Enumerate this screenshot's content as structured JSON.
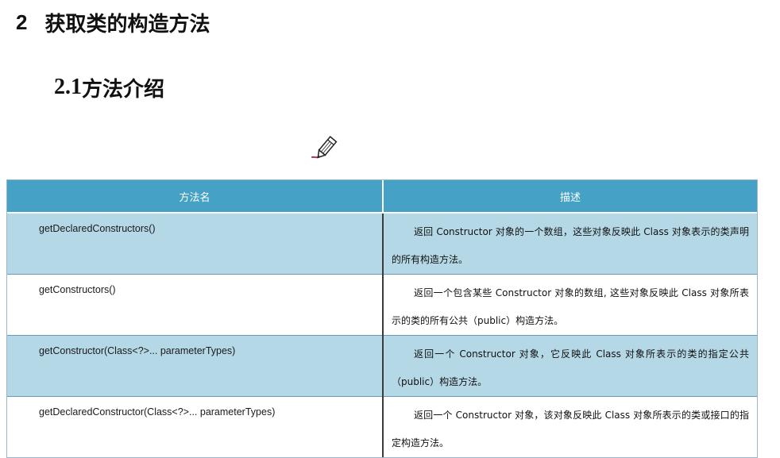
{
  "heading1": {
    "number": "2",
    "title": "获取类的构造方法"
  },
  "heading2": {
    "number": "2.1",
    "title": "方法介绍"
  },
  "table": {
    "headers": {
      "method": "方法名",
      "description": "描述"
    },
    "rows": [
      {
        "method": "getDeclaredConstructors()",
        "description": "返回 Constructor 对象的一个数组，这些对象反映此 Class 对象表示的类声明的所有构造方法。"
      },
      {
        "method": "getConstructors()",
        "description": "返回一个包含某些 Constructor 对象的数组, 这些对象反映此 Class 对象所表示的类的所有公共（public）构造方法。"
      },
      {
        "method": "getConstructor(Class<?>... parameterTypes)",
        "description": "返回一个 Constructor 对象，它反映此 Class 对象所表示的类的指定公共（public）构造方法。"
      },
      {
        "method": "getDeclaredConstructor(Class<?>... parameterTypes)",
        "description": "返回一个 Constructor 对象，该对象反映此 Class 对象所表示的类或接口的指定构造方法。"
      }
    ]
  },
  "colors": {
    "header_bg": "#45a2c6",
    "shaded_row_bg": "#b5d8e6"
  },
  "icons": {
    "cursor": "pencil-icon"
  }
}
